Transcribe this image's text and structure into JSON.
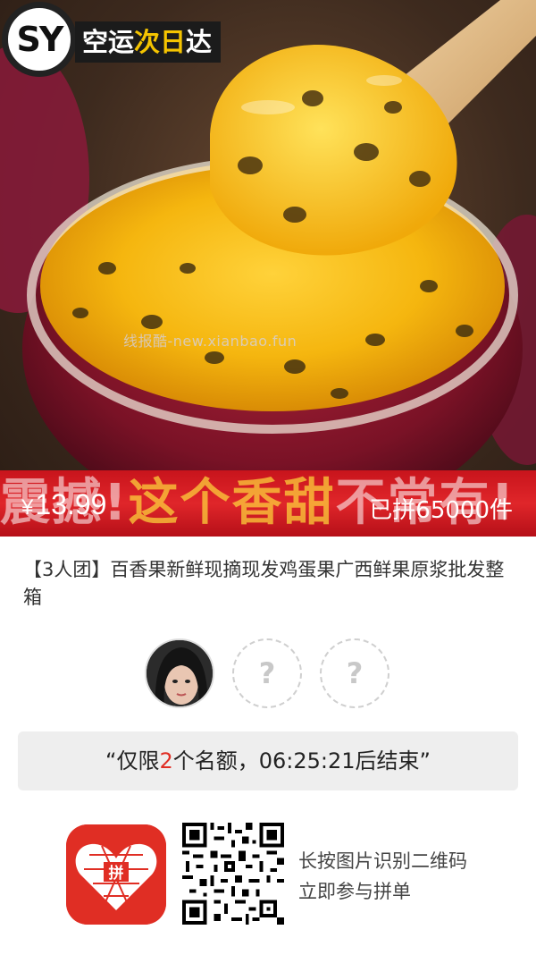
{
  "hero": {
    "logo_text": "SY",
    "shipping_tag_prefix": "空运",
    "shipping_tag_highlight": "次日",
    "shipping_tag_suffix": "达",
    "watermark": "线报酷-new.xianbao.fun",
    "slogan_part1": "震撼!",
    "slogan_part2": "这个香甜",
    "slogan_part3": "不常有!",
    "currency": "¥",
    "price": "13.99",
    "sold_text": "已拼65000件"
  },
  "product": {
    "title": "【3人团】百香果新鲜现摘现发鸡蛋果广西鲜果原浆批发整箱"
  },
  "group": {
    "empty_slot_symbol": "?"
  },
  "countdown": {
    "prefix": "“仅限",
    "count": "2",
    "suffix": "个名额，06:25:21后结束”"
  },
  "footer": {
    "app_icon_text": "拼",
    "hint_line1": "长按图片识别二维码",
    "hint_line2": "立即参与拼单"
  },
  "colors": {
    "accent": "#e02e24",
    "banner_red": "#d0181f",
    "countdown_bg": "#eeeeee"
  }
}
